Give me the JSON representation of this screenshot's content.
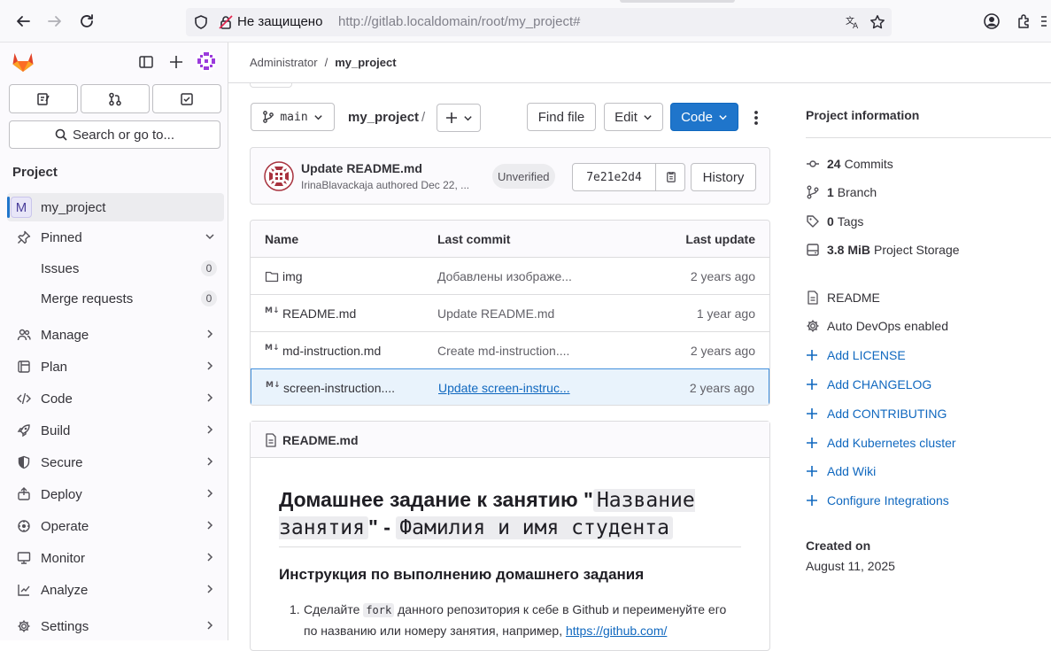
{
  "browser": {
    "security_label": "Не защищено",
    "url_prefix": "http://gitlab.localdomain",
    "url_path": "/root/my_project#"
  },
  "sidebar": {
    "search_label": "Search or go to...",
    "section_title": "Project",
    "project_name": "my_project",
    "project_initial": "M",
    "pinned_label": "Pinned",
    "pinned_items": [
      {
        "label": "Issues",
        "count": "0"
      },
      {
        "label": "Merge requests",
        "count": "0"
      }
    ],
    "nav": [
      {
        "label": "Manage",
        "icon": "users-icon"
      },
      {
        "label": "Plan",
        "icon": "plan-icon"
      },
      {
        "label": "Code",
        "icon": "code-icon"
      },
      {
        "label": "Build",
        "icon": "rocket-icon"
      },
      {
        "label": "Secure",
        "icon": "shield-icon"
      },
      {
        "label": "Deploy",
        "icon": "deploy-icon"
      },
      {
        "label": "Operate",
        "icon": "cloud-icon"
      },
      {
        "label": "Monitor",
        "icon": "monitor-icon"
      },
      {
        "label": "Analyze",
        "icon": "chart-icon"
      },
      {
        "label": "Settings",
        "icon": "gear-icon"
      }
    ]
  },
  "breadcrumb": {
    "parent": "Administrator",
    "sep": "/",
    "current": "my_project"
  },
  "toolbar": {
    "branch": "main",
    "repo_name": "my_project",
    "path_sep": "/",
    "find_file": "Find file",
    "edit": "Edit",
    "code": "Code"
  },
  "commit": {
    "title": "Update README.md",
    "meta": "IrinaBlavackaja authored Dec 22, ...",
    "badge": "Unverified",
    "sha": "7e21e2d4",
    "history": "History"
  },
  "files": {
    "headers": {
      "name": "Name",
      "last_commit": "Last commit",
      "last_update": "Last update"
    },
    "rows": [
      {
        "name": "img",
        "commit": "Добавлены изображе...",
        "updated": "2 years ago",
        "icon": "folder-icon"
      },
      {
        "name": "README.md",
        "commit": "Update README.md",
        "updated": "1 year ago",
        "icon": "markdown-icon"
      },
      {
        "name": "md-instruction.md",
        "commit": "Create md-instruction....",
        "updated": "2 years ago",
        "icon": "markdown-icon"
      },
      {
        "name": "screen-instruction....",
        "commit": "Update screen-instruc...",
        "updated": "2 years ago",
        "icon": "markdown-icon"
      }
    ]
  },
  "readme": {
    "file_label": "README.md",
    "h1_part1": "Домашнее задание к занятию \"",
    "h1_code1": "Название занятия",
    "h1_part2": "\" - ",
    "h1_code2": "Фамилия и имя студента",
    "h2": "Инструкция по выполнению домашнего задания",
    "li_num": "1.",
    "li_text1": "Сделайте ",
    "li_code": "fork",
    "li_text2": " данного репозитория к себе в Github и переименуйте его по названию или номеру занятия, например, ",
    "li_link": "https://github.com/"
  },
  "project_info": {
    "title": "Project information",
    "stats": [
      {
        "value": "24",
        "label": "Commits",
        "icon": "commit-icon"
      },
      {
        "value": "1",
        "label": "Branch",
        "icon": "branch-icon"
      },
      {
        "value": "0",
        "label": "Tags",
        "icon": "tag-icon"
      },
      {
        "value": "3.8 MiB",
        "label": "Project Storage",
        "icon": "storage-icon"
      }
    ],
    "readme": "README",
    "autodevops": "Auto DevOps enabled",
    "links": [
      "Add LICENSE",
      "Add CHANGELOG",
      "Add CONTRIBUTING",
      "Add Kubernetes cluster",
      "Add Wiki",
      "Configure Integrations"
    ],
    "created_label": "Created on",
    "created_date": "August 11, 2025"
  },
  "colors": {
    "primary": "#1f75cb",
    "link": "#1068bf",
    "selected_row": "#e9f3fc"
  }
}
